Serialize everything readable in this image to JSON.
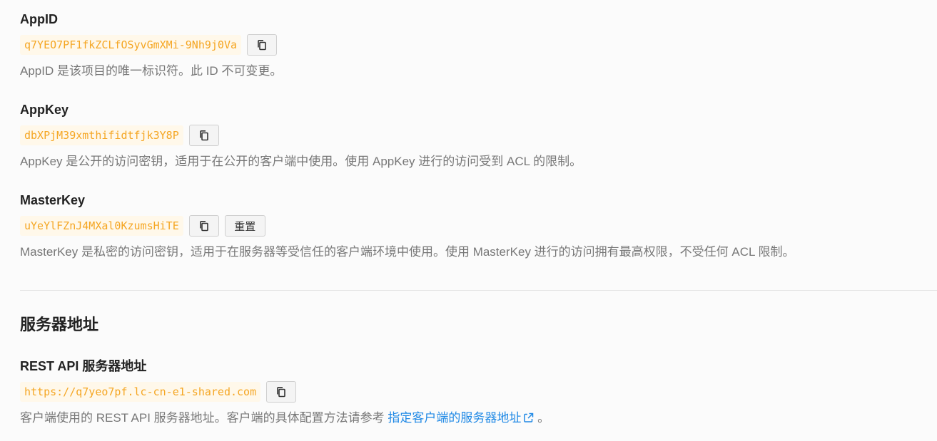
{
  "app_id": {
    "label": "AppID",
    "value": "q7YEO7PF1fkZCLfOSyvGmXMi-9Nh9j0Va",
    "copy_icon": "copy-icon",
    "description": "AppID 是该项目的唯一标识符。此 ID 不可变更。"
  },
  "app_key": {
    "label": "AppKey",
    "value": "dbXPjM39xmthifidtfjk3Y8P",
    "copy_icon": "copy-icon",
    "description": "AppKey 是公开的访问密钥，适用于在公开的客户端中使用。使用 AppKey 进行的访问受到 ACL 的限制。"
  },
  "master_key": {
    "label": "MasterKey",
    "value": "uYeYlFZnJ4MXal0KzumsHiTE",
    "copy_icon": "copy-icon",
    "reset_label": "重置",
    "description": "MasterKey 是私密的访问密钥，适用于在服务器等受信任的客户端环境中使用。使用 MasterKey 进行的访问拥有最高权限，不受任何 ACL 限制。"
  },
  "server_section": {
    "title": "服务器地址"
  },
  "rest_api": {
    "label": "REST API 服务器地址",
    "value": "https://q7yeo7pf.lc-cn-e1-shared.com",
    "copy_icon": "copy-icon",
    "description_prefix": "客户端使用的 REST API 服务器地址。客户端的具体配置方法请参考 ",
    "link_text": "指定客户端的服务器地址",
    "link_icon": "external-link-icon",
    "description_suffix": " 。"
  },
  "colors": {
    "code_text": "#f5a623",
    "code_bg": "#fff8ea",
    "link": "#1e88e5",
    "desc_text": "#777777"
  }
}
